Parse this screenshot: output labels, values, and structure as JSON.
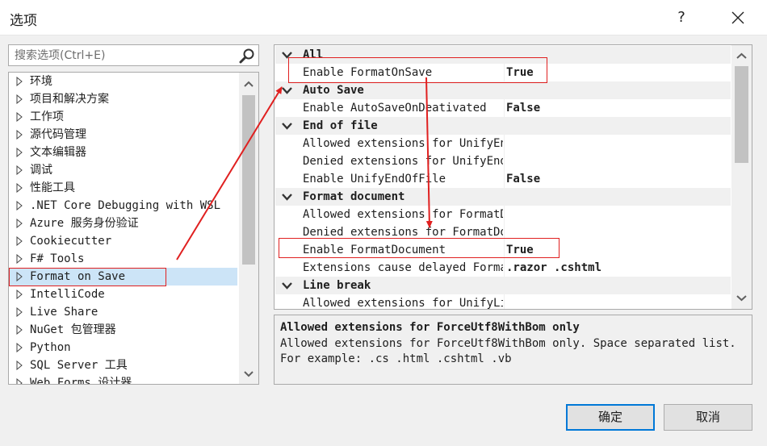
{
  "dialog": {
    "title": "选项",
    "help_label": "?"
  },
  "search": {
    "placeholder": "搜索选项(Ctrl+E)"
  },
  "tree": {
    "items": [
      {
        "label": "环境"
      },
      {
        "label": "项目和解决方案"
      },
      {
        "label": "工作项"
      },
      {
        "label": "源代码管理"
      },
      {
        "label": "文本编辑器"
      },
      {
        "label": "调试"
      },
      {
        "label": "性能工具"
      },
      {
        "label": ".NET Core Debugging with WSL"
      },
      {
        "label": "Azure 服务身份验证"
      },
      {
        "label": "Cookiecutter"
      },
      {
        "label": "F# Tools"
      },
      {
        "label": "Format on Save"
      },
      {
        "label": "IntelliCode"
      },
      {
        "label": "Live Share"
      },
      {
        "label": "NuGet 包管理器"
      },
      {
        "label": "Python"
      },
      {
        "label": "SQL Server 工具"
      },
      {
        "label": "Web Forms 设计器"
      }
    ]
  },
  "grid": {
    "rows": [
      {
        "type": "category",
        "label": "All"
      },
      {
        "type": "property",
        "name": "Enable FormatOnSave",
        "value": "True"
      },
      {
        "type": "category",
        "label": "Auto Save"
      },
      {
        "type": "property",
        "name": "Enable AutoSaveOnDeativated",
        "value": "False"
      },
      {
        "type": "category",
        "label": "End of file"
      },
      {
        "type": "property",
        "name": "Allowed extensions for UnifyEndOfFile",
        "value": ""
      },
      {
        "type": "property",
        "name": "Denied extensions for UnifyEndOfFile",
        "value": ""
      },
      {
        "type": "property",
        "name": "Enable UnifyEndOfFile",
        "value": "False"
      },
      {
        "type": "category",
        "label": "Format document"
      },
      {
        "type": "property",
        "name": "Allowed extensions for FormatDocument",
        "value": ""
      },
      {
        "type": "property",
        "name": "Denied extensions for FormatDocument",
        "value": ""
      },
      {
        "type": "property",
        "name": "Enable FormatDocument",
        "value": "True"
      },
      {
        "type": "property",
        "name": "Extensions cause delayed FormatDocument",
        "value": ".razor .cshtml"
      },
      {
        "type": "category",
        "label": "Line break"
      },
      {
        "type": "property",
        "name": "Allowed extensions for UnifyLineBreak",
        "value": ""
      }
    ]
  },
  "description": {
    "title": "Allowed extensions for ForceUtf8WithBom only",
    "body": "Allowed extensions for ForceUtf8WithBom only. Space separated list. For example: .cs .html .cshtml .vb"
  },
  "buttons": {
    "ok": "确定",
    "cancel": "取消"
  },
  "colors": {
    "annotation": "#e02020",
    "selection": "#cce4f7",
    "accent": "#0078d7"
  }
}
